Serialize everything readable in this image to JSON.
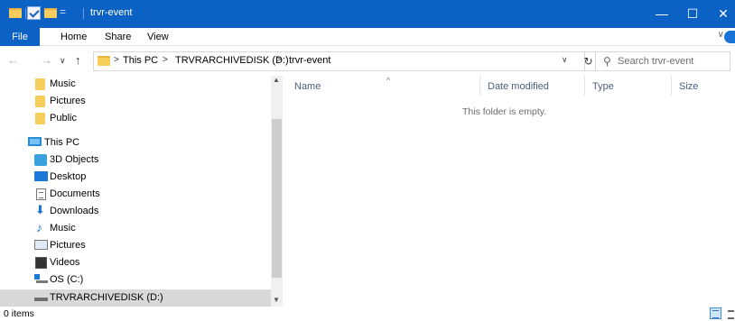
{
  "window": {
    "title": "trvr-event",
    "minimize_glyph": "—",
    "maximize_glyph": "☐",
    "close_glyph": "✕",
    "accent_color": "#0b61c4"
  },
  "ribbon": {
    "tabs": [
      "File",
      "Home",
      "Share",
      "View"
    ],
    "expand_glyph": "∨"
  },
  "address": {
    "back_glyph": "←",
    "forward_glyph": "→",
    "recent_glyph": "∨",
    "up_glyph": "↑",
    "crumbs": [
      "This PC",
      "TRVRARCHIVEDISK (D:)",
      "trvr-event"
    ],
    "separator_glyph": ">",
    "dropdown_glyph": "∨",
    "refresh_glyph": "↻"
  },
  "search": {
    "icon_glyph": "⚲",
    "placeholder": "Search trvr-event"
  },
  "navpane": {
    "items": [
      {
        "label": "Music",
        "icon": "folder-icon"
      },
      {
        "label": "Pictures",
        "icon": "folder-icon"
      },
      {
        "label": "Public",
        "icon": "folder-icon"
      },
      {
        "label": "This PC",
        "icon": "computer-icon"
      },
      {
        "label": "3D Objects",
        "icon": "3d-objects-icon"
      },
      {
        "label": "Desktop",
        "icon": "desktop-icon"
      },
      {
        "label": "Documents",
        "icon": "documents-icon"
      },
      {
        "label": "Downloads",
        "icon": "downloads-icon"
      },
      {
        "label": "Music",
        "icon": "music-icon"
      },
      {
        "label": "Pictures",
        "icon": "pictures-icon"
      },
      {
        "label": "Videos",
        "icon": "videos-icon"
      },
      {
        "label": "OS (C:)",
        "icon": "os-drive-icon"
      },
      {
        "label": "TRVRARCHIVEDISK (D:)",
        "icon": "drive-icon",
        "selected": true
      }
    ],
    "scroll_up_glyph": "▲",
    "scroll_down_glyph": "▼"
  },
  "content": {
    "columns": [
      "Name",
      "Date modified",
      "Type",
      "Size"
    ],
    "sort_glyph": "^",
    "empty_message": "This folder is empty."
  },
  "status": {
    "item_count": "0 items"
  },
  "icons": {
    "downloads_glyph": "⬇",
    "music_glyph": "♪"
  }
}
